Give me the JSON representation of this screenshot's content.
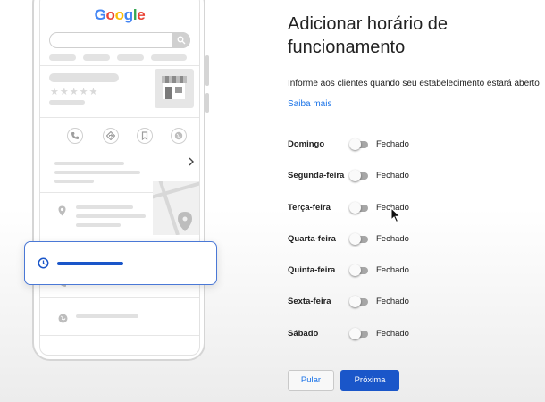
{
  "illustration": {
    "logo": [
      "G",
      "o",
      "o",
      "g",
      "l",
      "e"
    ],
    "icons": {
      "search": "search-icon",
      "store": "storefront-icon",
      "actions": [
        "phone-icon",
        "directions-icon",
        "bookmark-icon",
        "website-icon"
      ],
      "chevron": "chevron-right-icon",
      "location": "location-pin-icon",
      "map_pin": "map-pin-icon",
      "clock": "clock-icon",
      "phone_row": "phone-icon",
      "web_row": "globe-icon"
    },
    "stars": "★★★★★"
  },
  "colors": {
    "accent": "#1a56c9",
    "link": "#1a73e8",
    "google_blue": "#4285f4",
    "google_red": "#ea4335",
    "google_yellow": "#fbbc05",
    "google_green": "#34a853"
  },
  "panel": {
    "title": "Adicionar horário de funcionamento",
    "description": "Informe aos clientes quando seu estabelecimento estará aberto",
    "link": "Saiba mais",
    "days": [
      {
        "name": "Domingo",
        "status": "Fechado",
        "open": false
      },
      {
        "name": "Segunda-feira",
        "status": "Fechado",
        "open": false
      },
      {
        "name": "Terça-feira",
        "status": "Fechado",
        "open": false
      },
      {
        "name": "Quarta-feira",
        "status": "Fechado",
        "open": false
      },
      {
        "name": "Quinta-feira",
        "status": "Fechado",
        "open": false
      },
      {
        "name": "Sexta-feira",
        "status": "Fechado",
        "open": false
      },
      {
        "name": "Sábado",
        "status": "Fechado",
        "open": false
      }
    ],
    "skip_label": "Pular",
    "next_label": "Próxima"
  }
}
